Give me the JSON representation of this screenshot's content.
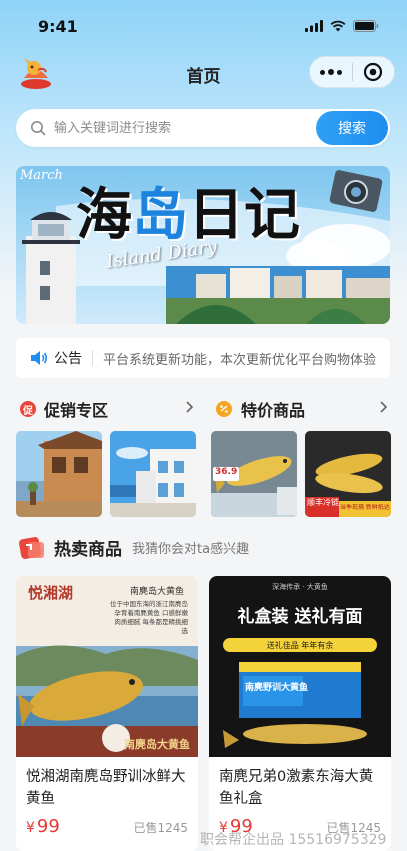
{
  "status_bar": {
    "time": "9:41"
  },
  "nav": {
    "title": "首页"
  },
  "search": {
    "placeholder": "输入关键词进行搜索",
    "button": "搜索"
  },
  "banner": {
    "month": "March",
    "title_a": "海",
    "title_b": "岛",
    "title_c": "日记",
    "subtitle": "Island Diary"
  },
  "notice": {
    "label": "公告",
    "text": "平台系统更新功能，本次更新优化平台购物体验"
  },
  "sections": {
    "promo": {
      "title": "促销专区",
      "icon_char": "促"
    },
    "special": {
      "title": "特价商品"
    }
  },
  "special_tags": {
    "price": "36.9",
    "tag1": "顺丰冷链",
    "tag2": "当季现捕 新鲜抵达"
  },
  "hot": {
    "title": "热卖商品",
    "subtitle": "我猜你会对ta感兴趣"
  },
  "products": [
    {
      "name": "悦湘湖南麂岛野训冰鲜大黄鱼",
      "price": "99",
      "sold": "已售1245",
      "img_brand": "悦湘湖",
      "img_label": "南麂岛大黄鱼",
      "img_desc": "位于中国东海的浙江南麂岛 孕育着南麂黄鱼 口感鲜嫩 肉质细腻 每条都是精挑细选"
    },
    {
      "name": "南麂兄弟0激素东海大黄鱼礼盒",
      "price": "99",
      "sold": "已售1245",
      "img_top": "深海传承 · 大黄鱼",
      "img_headline": "礼盒装 送礼有面",
      "img_sub": "送礼佳品 年年有余",
      "img_box": "南麂野训大黄鱼"
    }
  ],
  "watermark": "职会帮企出品 15516975329",
  "colors": {
    "accent": "#1f8ef0",
    "price": "#e53935",
    "promo_icon": "#e8453c",
    "special_icon": "#f4a623"
  }
}
